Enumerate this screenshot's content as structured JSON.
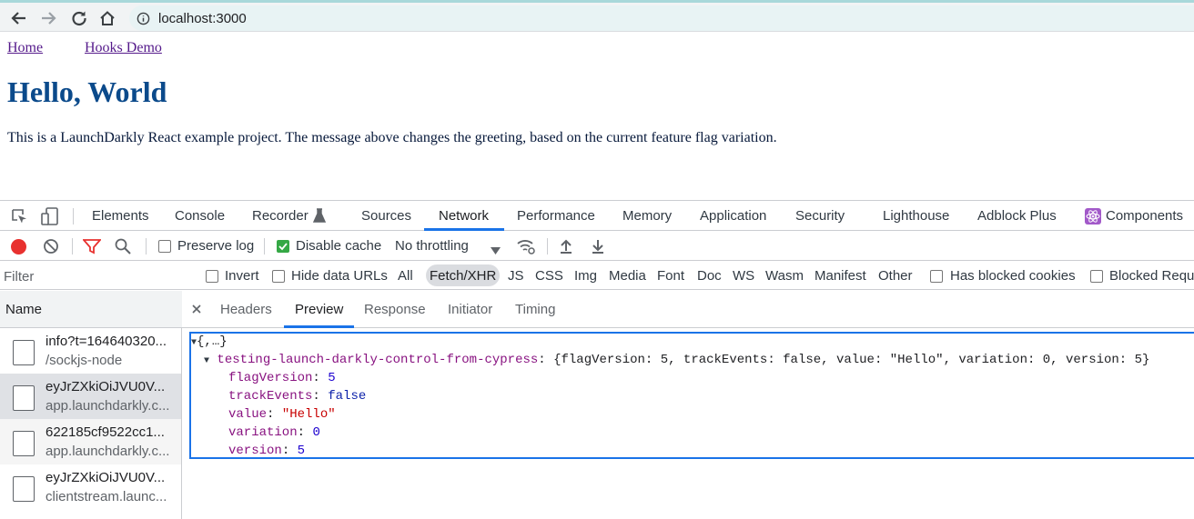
{
  "browser": {
    "url": "localhost:3000"
  },
  "page": {
    "nav": [
      "Home",
      "Hooks Demo"
    ],
    "title": "Hello, World",
    "paragraph": "This is a LaunchDarkly React example project. The message above changes the greeting, based on the current feature flag variation."
  },
  "devtools": {
    "tabs": [
      "Elements",
      "Console",
      "Recorder",
      "Sources",
      "Network",
      "Performance",
      "Memory",
      "Application",
      "Security",
      "Lighthouse",
      "Adblock Plus",
      "Components"
    ],
    "active_tab": "Network",
    "toolbar": {
      "preserve_log": "Preserve log",
      "disable_cache": "Disable cache",
      "throttling": "No throttling"
    },
    "filter": {
      "placeholder": "Filter",
      "invert": "Invert",
      "hide_data_urls": "Hide data URLs",
      "types": [
        "All",
        "Fetch/XHR",
        "JS",
        "CSS",
        "Img",
        "Media",
        "Font",
        "Doc",
        "WS",
        "Wasm",
        "Manifest",
        "Other"
      ],
      "active_type": "Fetch/XHR",
      "has_blocked_cookies": "Has blocked cookies",
      "blocked_requests": "Blocked Requ"
    },
    "requests": {
      "header": "Name",
      "rows": [
        {
          "name": "info?t=164640320...",
          "domain": "/sockjs-node"
        },
        {
          "name": "eyJrZXkiOiJVU0V...",
          "domain": "app.launchdarkly.c..."
        },
        {
          "name": "622185cf9522cc1...",
          "domain": "app.launchdarkly.c..."
        },
        {
          "name": "eyJrZXkiOiJVU0V...",
          "domain": "clientstream.launc..."
        }
      ]
    },
    "detail_tabs": [
      "Headers",
      "Preview",
      "Response",
      "Initiator",
      "Timing"
    ],
    "active_detail_tab": "Preview",
    "preview": {
      "root": "{,…}",
      "flag_key": "testing-launch-darkly-control-from-cypress",
      "flag_summary": "{flagVersion: 5, trackEvents: false, value: \"Hello\", variation: 0, version: 5}",
      "fields": [
        {
          "key": "flagVersion",
          "value": "5",
          "kind": "num"
        },
        {
          "key": "trackEvents",
          "value": "false",
          "kind": "kw"
        },
        {
          "key": "value",
          "value": "\"Hello\"",
          "kind": "str"
        },
        {
          "key": "variation",
          "value": "0",
          "kind": "num"
        },
        {
          "key": "version",
          "value": "5",
          "kind": "num"
        }
      ]
    }
  }
}
